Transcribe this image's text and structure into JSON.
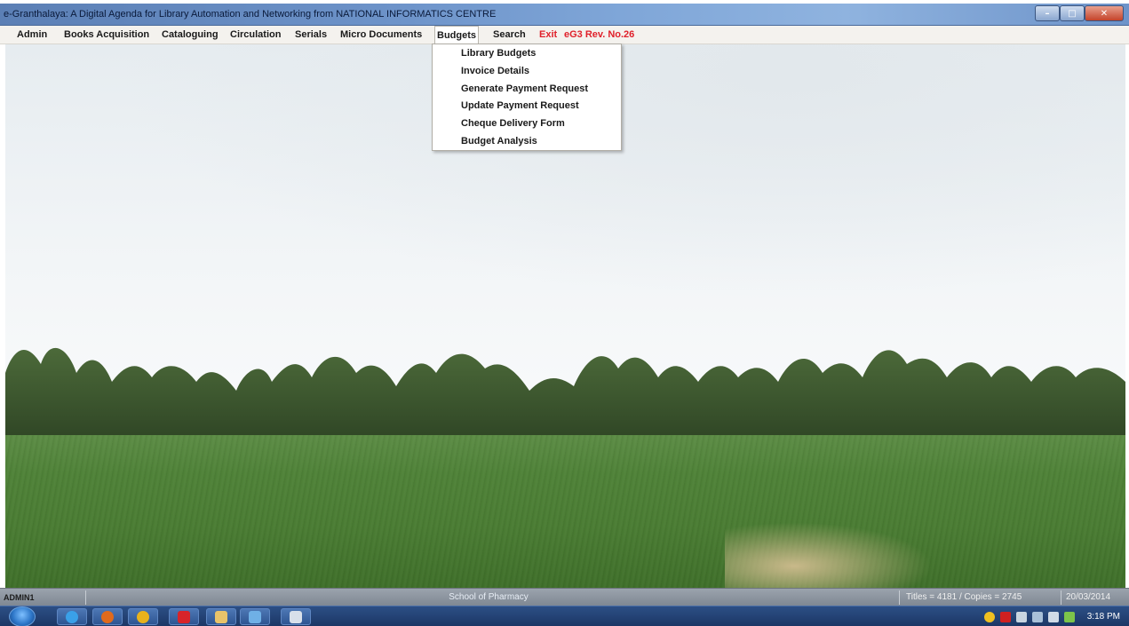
{
  "window": {
    "title": "e-Granthalaya: A Digital Agenda for Library Automation and Networking from NATIONAL INFORMATICS CENTRE",
    "controls": {
      "minimize": "–",
      "maximize": "□",
      "close": "✕"
    }
  },
  "menubar": {
    "items": [
      {
        "label": "Admin"
      },
      {
        "label": "Books Acquisition"
      },
      {
        "label": "Cataloguing"
      },
      {
        "label": "Circulation"
      },
      {
        "label": "Serials"
      },
      {
        "label": "Micro Documents"
      },
      {
        "label": "Budgets"
      },
      {
        "label": "Search"
      },
      {
        "label": "Exit"
      },
      {
        "label": "eG3 Rev. No.26"
      }
    ],
    "active": "Budgets"
  },
  "dropdown": {
    "items": [
      {
        "label": "Library Budgets"
      },
      {
        "label": "Invoice Details"
      },
      {
        "label": "Generate Payment Request"
      },
      {
        "label": "Update Payment Request"
      },
      {
        "label": "Cheque Delivery Form"
      },
      {
        "label": "Budget Analysis"
      }
    ]
  },
  "statusbar": {
    "user": "ADMIN1",
    "institution": "School of Pharmacy",
    "counts": "Titles = 4181 / Copies = 2745",
    "date": "20/03/2014"
  },
  "taskbar": {
    "apps": [
      {
        "icon": "internet-explorer-icon",
        "color": "#3aa0e8"
      },
      {
        "icon": "firefox-icon",
        "color": "#e06a1c"
      },
      {
        "icon": "chrome-icon",
        "color": "#e8b21c"
      },
      {
        "icon": "pdf-reader-icon",
        "color": "#d8242a"
      },
      {
        "icon": "file-explorer-icon",
        "color": "#e8c36a"
      },
      {
        "icon": "media-player-icon",
        "color": "#6fb0e6"
      },
      {
        "icon": "app-window-icon",
        "color": "#d8e0ea"
      }
    ],
    "tray": [
      {
        "icon": "tray-chrome-icon",
        "color": "#f0c020"
      },
      {
        "icon": "tray-antivirus-icon",
        "color": "#d02020"
      },
      {
        "icon": "tray-flag-icon",
        "color": "#c8d4e0"
      },
      {
        "icon": "tray-network-icon",
        "color": "#a8c0d8"
      },
      {
        "icon": "tray-volume-icon",
        "color": "#d0dae6"
      },
      {
        "icon": "tray-bars-icon",
        "color": "#7cc44a"
      }
    ],
    "clock": "3:18 PM"
  },
  "colors": {
    "menu_red": "#e0202a",
    "titlebar_blue": "#6d93c9",
    "taskbar_blue": "#1c3766"
  }
}
